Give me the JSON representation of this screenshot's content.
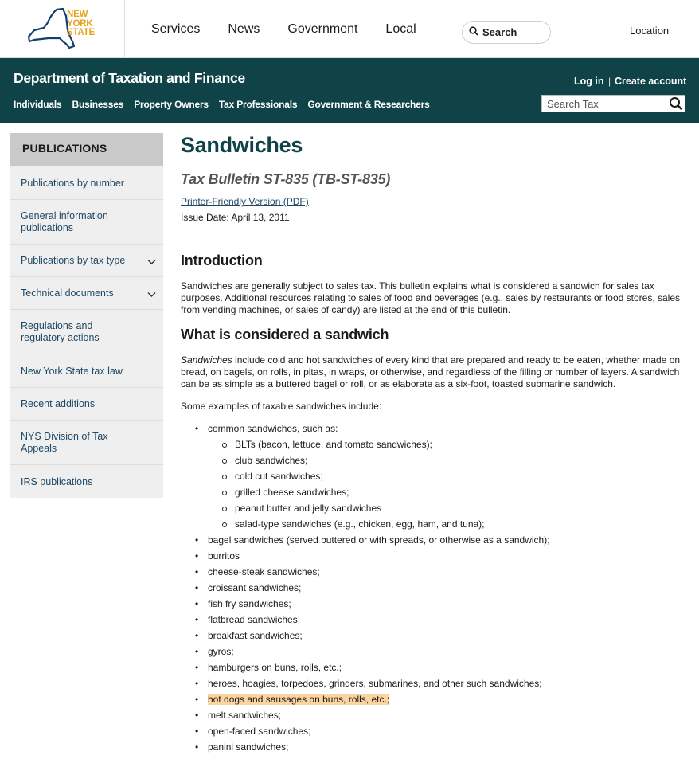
{
  "brand": {
    "line1": "NEW",
    "line2": "YORK",
    "line3": "STATE"
  },
  "topnav": [
    "Services",
    "News",
    "Government",
    "Local"
  ],
  "search_label": "Search",
  "location_label": "Location",
  "agency": {
    "title": "Department of Taxation and Finance",
    "login": "Log in",
    "separator": "|",
    "create_account": "Create account",
    "links": [
      "Individuals",
      "Businesses",
      "Property Owners",
      "Tax Professionals",
      "Government & Researchers"
    ],
    "search_placeholder": "Search Tax"
  },
  "sidebar": {
    "heading": "PUBLICATIONS",
    "items": [
      {
        "label": "Publications by number",
        "expand": false
      },
      {
        "label": "General information publications",
        "expand": false
      },
      {
        "label": "Publications by tax type",
        "expand": true
      },
      {
        "label": "Technical documents",
        "expand": true
      },
      {
        "label": "Regulations and regulatory actions",
        "expand": false
      },
      {
        "label": "New York State tax law",
        "expand": false
      },
      {
        "label": "Recent additions",
        "expand": false
      },
      {
        "label": "NYS Division of Tax Appeals",
        "expand": false
      },
      {
        "label": "IRS publications",
        "expand": false
      }
    ]
  },
  "main": {
    "title": "Sandwiches",
    "bulletin": "Tax Bulletin ST-835 (TB-ST-835)",
    "printer_link": "Printer-Friendly Version (PDF)",
    "issue_date": "Issue Date: April 13, 2011",
    "intro_heading": "Introduction",
    "intro_text": "Sandwiches are generally subject to sales tax. This bulletin explains what is considered a sandwich for sales tax purposes. Additional resources relating to sales of food and beverages (e.g., sales by restaurants or food stores, sales from vending machines, or sales of candy) are listed at the end of this bulletin.",
    "what_heading": "What is considered a sandwich",
    "what_em": "Sandwiches",
    "what_text": " include cold and hot sandwiches of every kind that are prepared and ready to be eaten, whether made on bread, on bagels, on rolls, in pitas, in wraps, or otherwise, and regardless of the filling or number of layers. A sandwich can be as simple as a buttered bagel or roll, or as elaborate as a six-foot, toasted submarine sandwich.",
    "examples_intro": "Some examples of taxable sandwiches include:",
    "common_label": "common sandwiches, such as:",
    "common_items": [
      "BLTs (bacon, lettuce, and tomato sandwiches);",
      "club sandwiches;",
      "cold cut sandwiches;",
      "grilled cheese sandwiches;",
      "peanut butter and jelly sandwiches",
      "salad-type sandwiches (e.g., chicken, egg, ham, and tuna);"
    ],
    "other_items": [
      "bagel sandwiches (served buttered or with spreads, or otherwise as a sandwich);",
      "burritos",
      "cheese-steak sandwiches;",
      "croissant sandwiches;",
      "fish fry sandwiches;",
      "flatbread sandwiches;",
      "breakfast sandwiches;",
      "gyros;",
      "hamburgers on buns, rolls, etc.;",
      "heroes, hoagies, torpedoes, grinders, submarines, and other such sandwiches;",
      "hot dogs and sausages on buns, rolls, etc.;",
      "melt sandwiches;",
      "open-faced sandwiches;",
      "panini sandwiches;"
    ],
    "highlight_color": "#fbd4a0"
  }
}
